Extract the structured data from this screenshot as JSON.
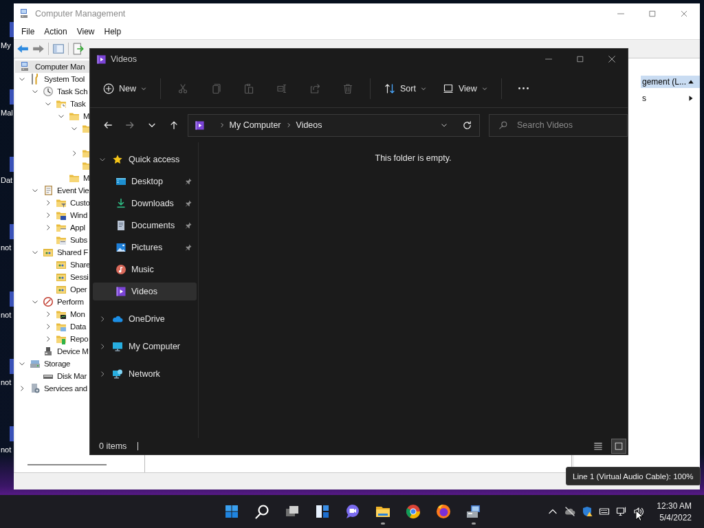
{
  "desktop": {
    "icons": [
      {
        "label": "My"
      },
      {
        "label": "Mal"
      },
      {
        "label": "Dat"
      },
      {
        "label": "not"
      },
      {
        "label": "not"
      },
      {
        "label": "not"
      },
      {
        "label": "not"
      }
    ]
  },
  "computer_management": {
    "title": "Computer Management",
    "menu": [
      "File",
      "Action",
      "View",
      "Help"
    ],
    "tree": [
      {
        "label": "Computer Man",
        "kind": "computer",
        "children": [
          {
            "label": "System Tool",
            "kind": "tools",
            "expanded": true,
            "children": [
              {
                "label": "Task Sch",
                "kind": "clock",
                "expanded": true,
                "children": [
                  {
                    "label": "Task",
                    "kind": "folder-clock",
                    "expanded": true,
                    "children": [
                      {
                        "label": "M",
                        "kind": "folder",
                        "expanded": true,
                        "children": [
                          {
                            "kind": "folder",
                            "expanded": true
                          },
                          {
                            "kind": "folder",
                            "expanded": false
                          },
                          {
                            "kind": "folder"
                          }
                        ]
                      },
                      {
                        "label": "M",
                        "kind": "folder"
                      }
                    ]
                  }
                ]
              },
              {
                "label": "Event Vie",
                "kind": "event",
                "expanded": true,
                "children": [
                  {
                    "label": "Custo",
                    "kind": "folder-filter",
                    "expanded": false
                  },
                  {
                    "label": "Wind",
                    "kind": "folder-window",
                    "expanded": false
                  },
                  {
                    "label": "Appl",
                    "kind": "folder-app",
                    "expanded": false
                  },
                  {
                    "label": "Subs",
                    "kind": "folder-sub"
                  }
                ]
              },
              {
                "label": "Shared F",
                "kind": "shared",
                "expanded": true,
                "children": [
                  {
                    "label": "Share",
                    "kind": "shared"
                  },
                  {
                    "label": "Sessi",
                    "kind": "shared"
                  },
                  {
                    "label": "Oper",
                    "kind": "shared"
                  }
                ]
              },
              {
                "label": "Perform",
                "kind": "perf",
                "expanded": true,
                "children": [
                  {
                    "label": "Mon",
                    "kind": "folder-monitor",
                    "expanded": false
                  },
                  {
                    "label": "Data",
                    "kind": "folder-data",
                    "expanded": false
                  },
                  {
                    "label": "Repo",
                    "kind": "folder-report",
                    "expanded": false
                  }
                ]
              },
              {
                "label": "Device M",
                "kind": "device"
              }
            ]
          },
          {
            "label": "Storage",
            "kind": "storage",
            "expanded": true,
            "children": [
              {
                "label": "Disk Mar",
                "kind": "disk"
              }
            ]
          },
          {
            "label": "Services and",
            "kind": "services",
            "expanded": false
          }
        ]
      }
    ],
    "actions": {
      "header": "gement (L...",
      "items": [
        "s"
      ]
    }
  },
  "explorer": {
    "title": "Videos",
    "commands": [
      {
        "kind": "new",
        "label": "New",
        "disabled": false
      },
      {
        "kind": "cut",
        "disabled": true
      },
      {
        "kind": "copy",
        "disabled": true
      },
      {
        "kind": "paste",
        "disabled": true
      },
      {
        "kind": "rename",
        "disabled": true
      },
      {
        "kind": "share",
        "disabled": true
      },
      {
        "kind": "delete",
        "disabled": true
      },
      {
        "kind": "sort",
        "label": "Sort",
        "disabled": false
      },
      {
        "kind": "view",
        "label": "View",
        "disabled": false
      },
      {
        "kind": "more",
        "disabled": false
      }
    ],
    "nav_buttons": [
      {
        "kind": "back",
        "disabled": false
      },
      {
        "kind": "forward",
        "disabled": true
      },
      {
        "kind": "recent",
        "disabled": false
      },
      {
        "kind": "up",
        "disabled": false
      }
    ],
    "address": [
      "My Computer",
      "Videos"
    ],
    "search": {
      "placeholder": "Search Videos"
    },
    "nav_pane": [
      {
        "label": "Quick access",
        "kind": "star",
        "expanded": true,
        "children": [
          {
            "label": "Desktop",
            "kind": "desktop",
            "pinned": true,
            "selected": false
          },
          {
            "label": "Downloads",
            "kind": "downloads",
            "pinned": true,
            "selected": false
          },
          {
            "label": "Documents",
            "kind": "documents",
            "pinned": true,
            "selected": false
          },
          {
            "label": "Pictures",
            "kind": "pictures",
            "pinned": true,
            "selected": false
          },
          {
            "label": "Music",
            "kind": "music",
            "pinned": false,
            "selected": false
          },
          {
            "label": "Videos",
            "kind": "videos",
            "pinned": false,
            "selected": true
          }
        ]
      },
      {
        "label": "OneDrive",
        "kind": "onedrive",
        "expanded": false
      },
      {
        "label": "My Computer",
        "kind": "computer",
        "expanded": false
      },
      {
        "label": "Network",
        "kind": "network",
        "expanded": false
      }
    ],
    "empty_message": "This folder is empty.",
    "status": "0 items",
    "view_modes": [
      {
        "kind": "details",
        "selected": false
      },
      {
        "kind": "tiles",
        "selected": true
      }
    ]
  },
  "taskbar": {
    "apps": [
      {
        "kind": "start",
        "running": false
      },
      {
        "kind": "search",
        "running": false
      },
      {
        "kind": "task-view",
        "running": false
      },
      {
        "kind": "widgets",
        "running": false
      },
      {
        "kind": "chat",
        "running": false
      },
      {
        "kind": "file-explorer",
        "running": true
      },
      {
        "kind": "chrome",
        "running": false
      },
      {
        "kind": "firefox",
        "running": false
      },
      {
        "kind": "computer-management",
        "running": true
      }
    ],
    "tray": [
      {
        "kind": "chevron"
      },
      {
        "kind": "onedrive"
      },
      {
        "kind": "security"
      },
      {
        "kind": "keyboard"
      },
      {
        "kind": "network"
      },
      {
        "kind": "volume"
      }
    ],
    "time": "12:30 AM",
    "date": "5/4/2022"
  },
  "tooltip": "Line 1 (Virtual Audio Cable): 100%"
}
